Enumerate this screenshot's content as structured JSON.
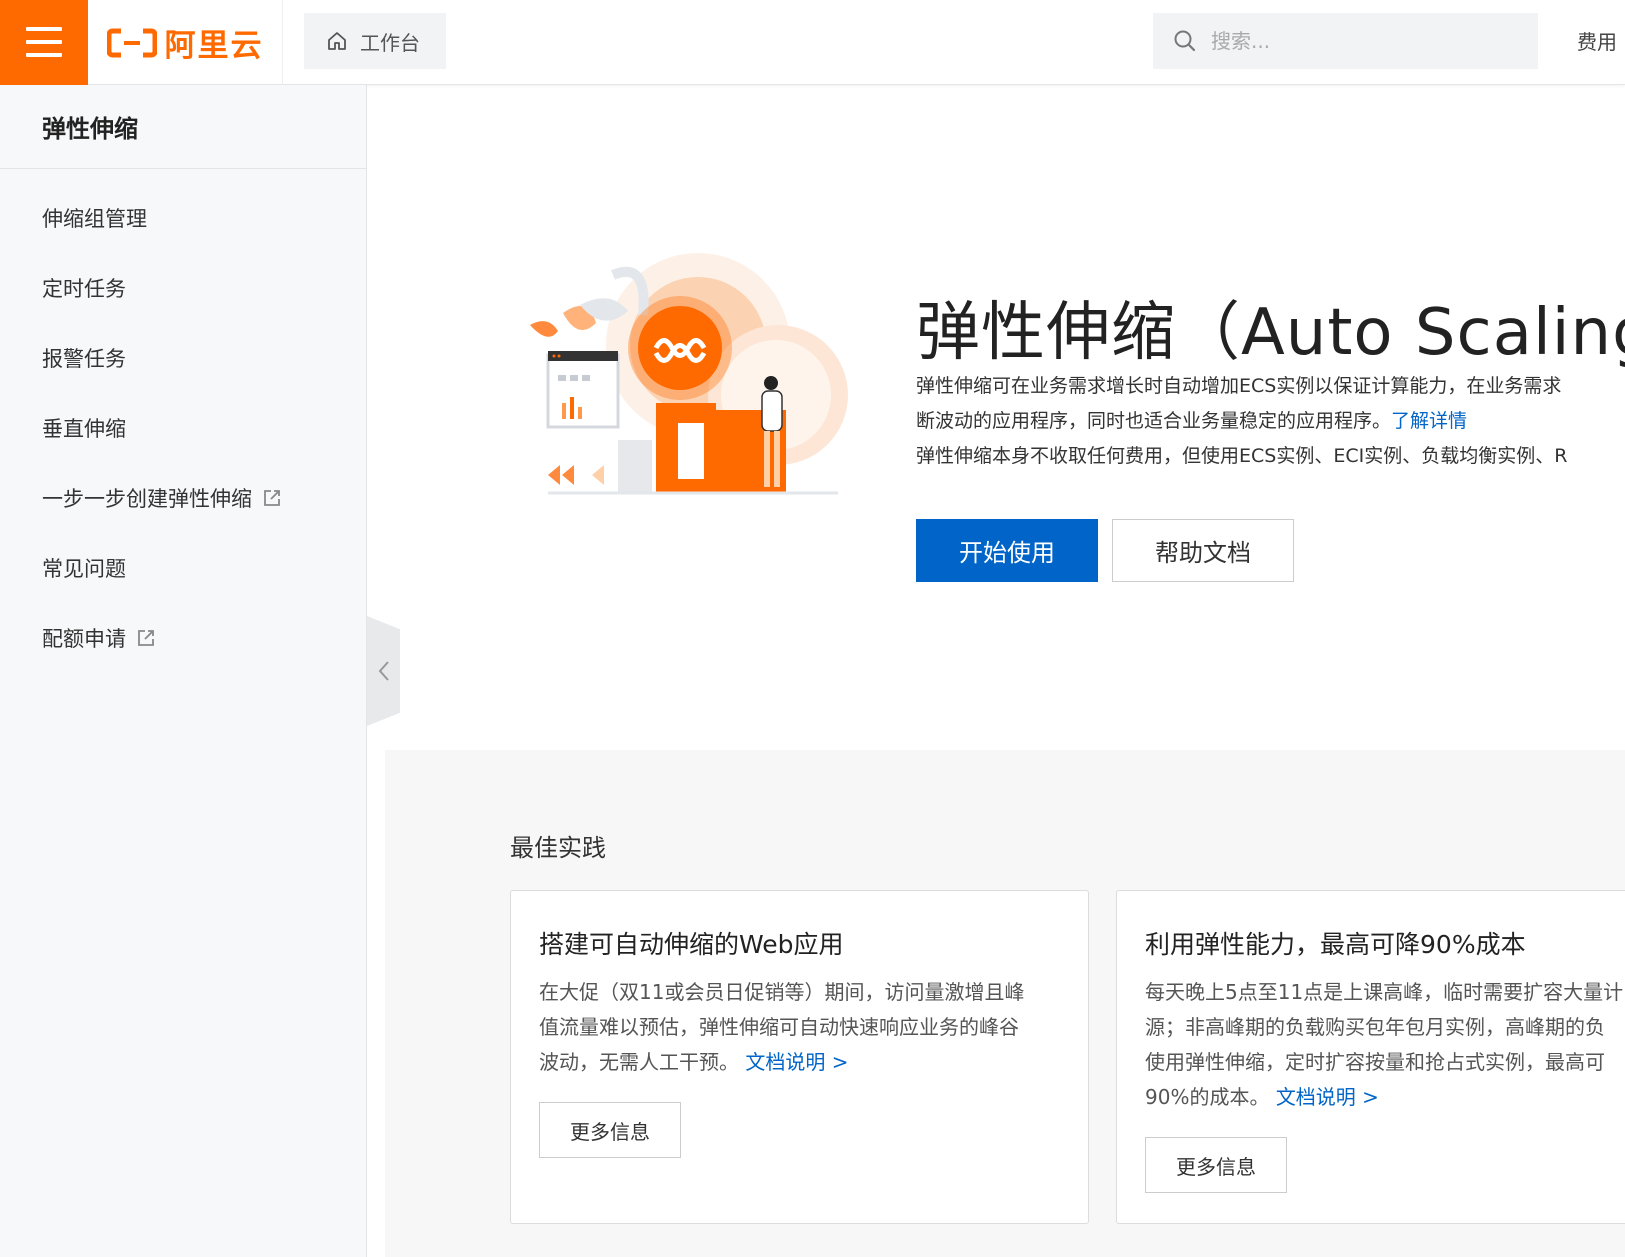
{
  "header": {
    "logo_text": "阿里云",
    "workbench_label": "工作台",
    "search_placeholder": "搜索...",
    "fees_label": "费用"
  },
  "sidebar": {
    "title": "弹性伸缩",
    "items": [
      {
        "label": "伸缩组管理",
        "external": false
      },
      {
        "label": "定时任务",
        "external": false
      },
      {
        "label": "报警任务",
        "external": false
      },
      {
        "label": "垂直伸缩",
        "external": false
      },
      {
        "label": "一步一步创建弹性伸缩",
        "external": true
      },
      {
        "label": "常见问题",
        "external": false
      },
      {
        "label": "配额申请",
        "external": true
      }
    ]
  },
  "hero": {
    "title": "弹性伸缩（Auto Scaling）",
    "desc_line1": "弹性伸缩可在业务需求增长时自动增加ECS实例以保证计算能力，在业务需求",
    "desc_line2": "断波动的应用程序，同时也适合业务量稳定的应用程序。",
    "desc_link": "了解详情",
    "desc_line3": "弹性伸缩本身不收取任何费用，但使用ECS实例、ECI实例、负载均衡实例、R",
    "primary_button": "开始使用",
    "secondary_button": "帮助文档"
  },
  "best_practice": {
    "title": "最佳实践",
    "cards": [
      {
        "title": "搭建可自动伸缩的Web应用",
        "lines": [
          "在大促（双11或会员日促销等）期间，访问量激增且峰",
          "值流量难以预估，弹性伸缩可自动快速响应业务的峰谷",
          "波动，无需人工干预。"
        ],
        "link": "文档说明 >",
        "button": "更多信息"
      },
      {
        "title": "利用弹性能力，最高可降90%成本",
        "lines": [
          "每天晚上5点至11点是上课高峰，临时需要扩容大量计",
          "源；非高峰期的负载购买包年包月实例，高峰期的负",
          "使用弹性伸缩，定时扩容按量和抢占式实例，最高可",
          "90%的成本。"
        ],
        "link": "文档说明 >",
        "button": "更多信息"
      }
    ]
  },
  "colors": {
    "brand_orange": "#ff6a00",
    "primary_blue": "#0064c8"
  }
}
